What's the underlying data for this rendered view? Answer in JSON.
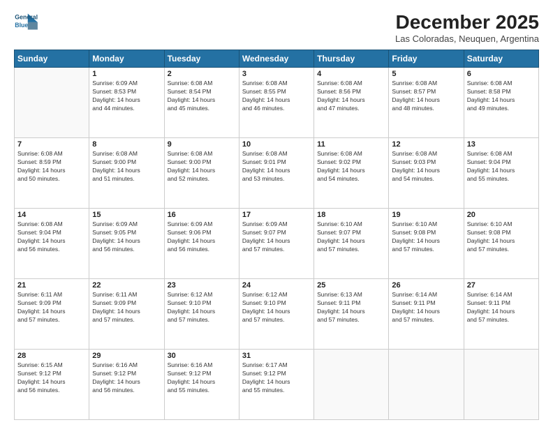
{
  "logo": {
    "line1": "General",
    "line2": "Blue"
  },
  "title": "December 2025",
  "subtitle": "Las Coloradas, Neuquen, Argentina",
  "days": [
    "Sunday",
    "Monday",
    "Tuesday",
    "Wednesday",
    "Thursday",
    "Friday",
    "Saturday"
  ],
  "weeks": [
    [
      {
        "day": "",
        "info": ""
      },
      {
        "day": "1",
        "info": "Sunrise: 6:09 AM\nSunset: 8:53 PM\nDaylight: 14 hours\nand 44 minutes."
      },
      {
        "day": "2",
        "info": "Sunrise: 6:08 AM\nSunset: 8:54 PM\nDaylight: 14 hours\nand 45 minutes."
      },
      {
        "day": "3",
        "info": "Sunrise: 6:08 AM\nSunset: 8:55 PM\nDaylight: 14 hours\nand 46 minutes."
      },
      {
        "day": "4",
        "info": "Sunrise: 6:08 AM\nSunset: 8:56 PM\nDaylight: 14 hours\nand 47 minutes."
      },
      {
        "day": "5",
        "info": "Sunrise: 6:08 AM\nSunset: 8:57 PM\nDaylight: 14 hours\nand 48 minutes."
      },
      {
        "day": "6",
        "info": "Sunrise: 6:08 AM\nSunset: 8:58 PM\nDaylight: 14 hours\nand 49 minutes."
      }
    ],
    [
      {
        "day": "7",
        "info": "Sunrise: 6:08 AM\nSunset: 8:59 PM\nDaylight: 14 hours\nand 50 minutes."
      },
      {
        "day": "8",
        "info": "Sunrise: 6:08 AM\nSunset: 9:00 PM\nDaylight: 14 hours\nand 51 minutes."
      },
      {
        "day": "9",
        "info": "Sunrise: 6:08 AM\nSunset: 9:00 PM\nDaylight: 14 hours\nand 52 minutes."
      },
      {
        "day": "10",
        "info": "Sunrise: 6:08 AM\nSunset: 9:01 PM\nDaylight: 14 hours\nand 53 minutes."
      },
      {
        "day": "11",
        "info": "Sunrise: 6:08 AM\nSunset: 9:02 PM\nDaylight: 14 hours\nand 54 minutes."
      },
      {
        "day": "12",
        "info": "Sunrise: 6:08 AM\nSunset: 9:03 PM\nDaylight: 14 hours\nand 54 minutes."
      },
      {
        "day": "13",
        "info": "Sunrise: 6:08 AM\nSunset: 9:04 PM\nDaylight: 14 hours\nand 55 minutes."
      }
    ],
    [
      {
        "day": "14",
        "info": "Sunrise: 6:08 AM\nSunset: 9:04 PM\nDaylight: 14 hours\nand 56 minutes."
      },
      {
        "day": "15",
        "info": "Sunrise: 6:09 AM\nSunset: 9:05 PM\nDaylight: 14 hours\nand 56 minutes."
      },
      {
        "day": "16",
        "info": "Sunrise: 6:09 AM\nSunset: 9:06 PM\nDaylight: 14 hours\nand 56 minutes."
      },
      {
        "day": "17",
        "info": "Sunrise: 6:09 AM\nSunset: 9:07 PM\nDaylight: 14 hours\nand 57 minutes."
      },
      {
        "day": "18",
        "info": "Sunrise: 6:10 AM\nSunset: 9:07 PM\nDaylight: 14 hours\nand 57 minutes."
      },
      {
        "day": "19",
        "info": "Sunrise: 6:10 AM\nSunset: 9:08 PM\nDaylight: 14 hours\nand 57 minutes."
      },
      {
        "day": "20",
        "info": "Sunrise: 6:10 AM\nSunset: 9:08 PM\nDaylight: 14 hours\nand 57 minutes."
      }
    ],
    [
      {
        "day": "21",
        "info": "Sunrise: 6:11 AM\nSunset: 9:09 PM\nDaylight: 14 hours\nand 57 minutes."
      },
      {
        "day": "22",
        "info": "Sunrise: 6:11 AM\nSunset: 9:09 PM\nDaylight: 14 hours\nand 57 minutes."
      },
      {
        "day": "23",
        "info": "Sunrise: 6:12 AM\nSunset: 9:10 PM\nDaylight: 14 hours\nand 57 minutes."
      },
      {
        "day": "24",
        "info": "Sunrise: 6:12 AM\nSunset: 9:10 PM\nDaylight: 14 hours\nand 57 minutes."
      },
      {
        "day": "25",
        "info": "Sunrise: 6:13 AM\nSunset: 9:11 PM\nDaylight: 14 hours\nand 57 minutes."
      },
      {
        "day": "26",
        "info": "Sunrise: 6:14 AM\nSunset: 9:11 PM\nDaylight: 14 hours\nand 57 minutes."
      },
      {
        "day": "27",
        "info": "Sunrise: 6:14 AM\nSunset: 9:11 PM\nDaylight: 14 hours\nand 57 minutes."
      }
    ],
    [
      {
        "day": "28",
        "info": "Sunrise: 6:15 AM\nSunset: 9:12 PM\nDaylight: 14 hours\nand 56 minutes."
      },
      {
        "day": "29",
        "info": "Sunrise: 6:16 AM\nSunset: 9:12 PM\nDaylight: 14 hours\nand 56 minutes."
      },
      {
        "day": "30",
        "info": "Sunrise: 6:16 AM\nSunset: 9:12 PM\nDaylight: 14 hours\nand 55 minutes."
      },
      {
        "day": "31",
        "info": "Sunrise: 6:17 AM\nSunset: 9:12 PM\nDaylight: 14 hours\nand 55 minutes."
      },
      {
        "day": "",
        "info": ""
      },
      {
        "day": "",
        "info": ""
      },
      {
        "day": "",
        "info": ""
      }
    ]
  ]
}
